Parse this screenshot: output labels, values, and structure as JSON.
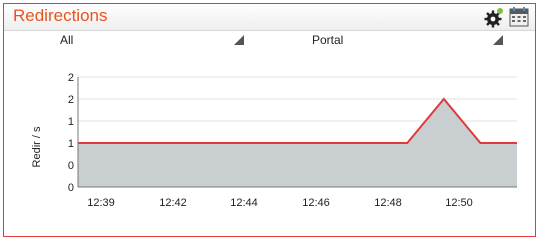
{
  "widget": {
    "title": "Redirections",
    "icons": [
      "gear-icon",
      "calendar-icon"
    ],
    "accent_color": "#e8541e",
    "border_color": "#e03a3a"
  },
  "filters": {
    "left_select": {
      "value": "All"
    },
    "right_select": {
      "value": "Portal"
    }
  },
  "chart_data": {
    "type": "area",
    "ylabel": "Redir / s",
    "xlabel": "",
    "x": [
      "12:39",
      "12:40",
      "12:41",
      "12:42",
      "12:43",
      "12:44",
      "12:45",
      "12:46",
      "12:47",
      "12:48",
      "12:49",
      "12:50",
      "12:51"
    ],
    "y_ticks": [
      "0",
      "0",
      "1",
      "1",
      "2",
      "2"
    ],
    "x_ticks": [
      "12:39",
      "12:42",
      "12:44",
      "12:46",
      "12:48",
      "12:50"
    ],
    "series": [
      {
        "values": [
          1,
          1,
          1,
          1,
          1,
          1,
          1,
          1,
          1,
          1,
          2,
          1,
          1
        ],
        "line_color": "#e03a3a",
        "fill_color": "#c9cfd1"
      }
    ],
    "grid": true
  }
}
